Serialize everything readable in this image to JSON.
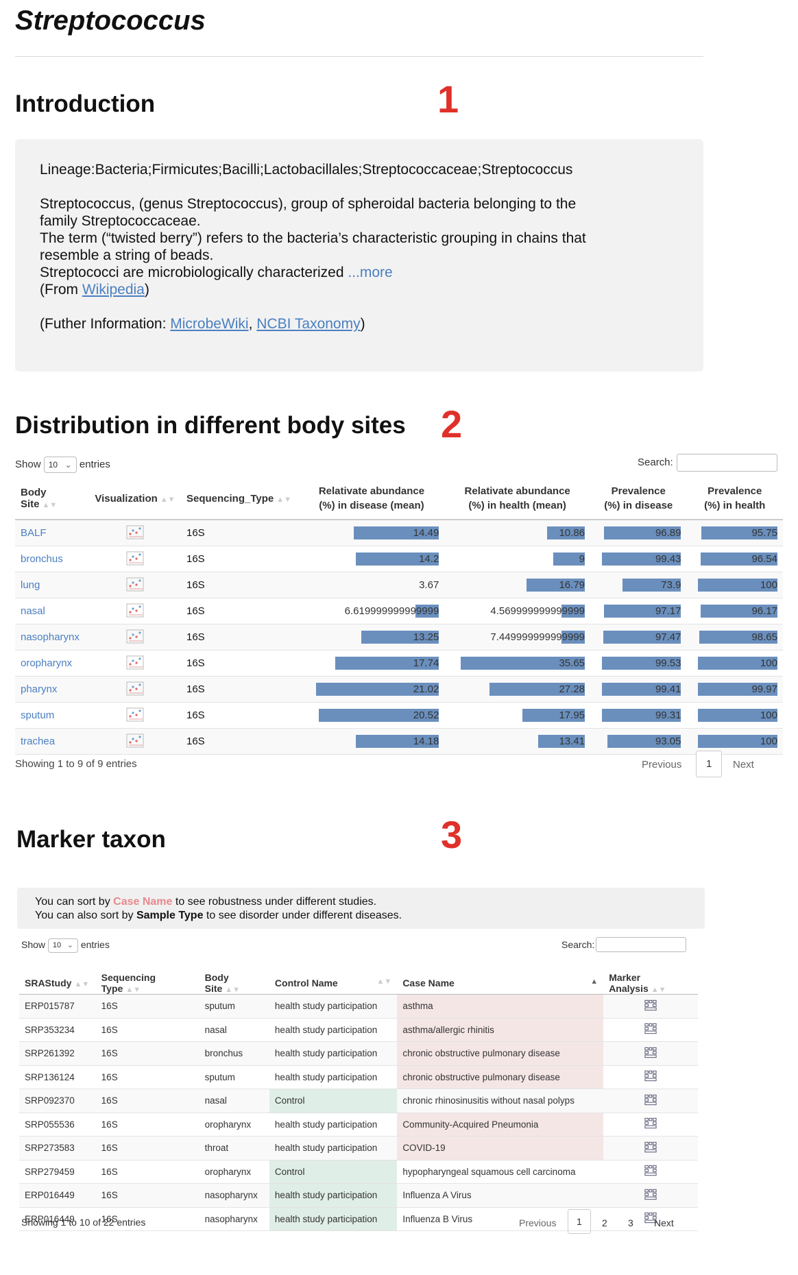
{
  "page": {
    "title": "Streptococcus"
  },
  "markers": [
    "1",
    "2",
    "3"
  ],
  "introduction": {
    "heading": "Introduction",
    "lineage": "Lineage:Bacteria;Firmicutes;Bacilli;Lactobacillales;Streptococcaceae;Streptococcus",
    "desc_line1": "Streptococcus, (genus Streptococcus), group of spheroidal bacteria belonging to the",
    "desc_line2": "family Streptococcaceae.",
    "desc_line3": "The term (“twisted berry”) refers to the bacteria’s characteristic grouping in chains that",
    "desc_line4": "resemble a string of beads.",
    "desc_line5": "Streptococci are microbiologically characterized ",
    "more_link": "...more",
    "from_prefix": "(From ",
    "wikipedia_link": "Wikipedia",
    "from_suffix": ")",
    "further_prefix": "(Futher Information: ",
    "microbewiki_link": "MicrobeWiki",
    "separator": ", ",
    "ncbi_link": "NCBI Taxonomy",
    "further_suffix": ")"
  },
  "distribution": {
    "heading": "Distribution in different body sites",
    "show_label": "Show",
    "entries_value": "10",
    "entries_label": "entries",
    "search_label": "Search:",
    "columns": {
      "body_site": "Body Site",
      "visualization": "Visualization",
      "sequencing_type": "Sequencing_Type",
      "abund_disease_1": "Relativate abundance",
      "abund_disease_2": "(%) in disease (mean)",
      "abund_health_1": "Relativate abundance",
      "abund_health_2": "(%) in health (mean)",
      "prev_disease_1": "Prevalence",
      "prev_disease_2": "(%) in disease",
      "prev_health_1": "Prevalence",
      "prev_health_2": "(%) in health"
    },
    "rows": [
      {
        "site": "BALF",
        "seq": "16S",
        "ad": "14.49",
        "ah": "10.86",
        "pd": "96.89",
        "ph": "95.75",
        "adv": 14.49,
        "ahv": 10.86,
        "pdv": 96.89,
        "phv": 95.75
      },
      {
        "site": "bronchus",
        "seq": "16S",
        "ad": "14.2",
        "ah": "9",
        "pd": "99.43",
        "ph": "96.54",
        "adv": 14.2,
        "ahv": 9,
        "pdv": 99.43,
        "phv": 96.54
      },
      {
        "site": "lung",
        "seq": "16S",
        "ad": "3.67",
        "ah": "16.79",
        "pd": "73.9",
        "ph": "100",
        "adv": 3.67,
        "ahv": 16.79,
        "pdv": 73.9,
        "phv": 100
      },
      {
        "site": "nasal",
        "seq": "16S",
        "ad": "6.619999999999999",
        "ah": "4.569999999999999",
        "pd": "97.17",
        "ph": "96.17",
        "adv": 6.62,
        "ahv": 4.57,
        "pdv": 97.17,
        "phv": 96.17
      },
      {
        "site": "nasopharynx",
        "seq": "16S",
        "ad": "13.25",
        "ah": "7.449999999999999",
        "pd": "97.47",
        "ph": "98.65",
        "adv": 13.25,
        "ahv": 7.45,
        "pdv": 97.47,
        "phv": 98.65
      },
      {
        "site": "oropharynx",
        "seq": "16S",
        "ad": "17.74",
        "ah": "35.65",
        "pd": "99.53",
        "ph": "100",
        "adv": 17.74,
        "ahv": 35.65,
        "pdv": 99.53,
        "phv": 100
      },
      {
        "site": "pharynx",
        "seq": "16S",
        "ad": "21.02",
        "ah": "27.28",
        "pd": "99.41",
        "ph": "99.97",
        "adv": 21.02,
        "ahv": 27.28,
        "pdv": 99.41,
        "phv": 99.97
      },
      {
        "site": "sputum",
        "seq": "16S",
        "ad": "20.52",
        "ah": "17.95",
        "pd": "99.31",
        "ph": "100",
        "adv": 20.52,
        "ahv": 17.95,
        "pdv": 99.31,
        "phv": 100
      },
      {
        "site": "trachea",
        "seq": "16S",
        "ad": "14.18",
        "ah": "13.41",
        "pd": "93.05",
        "ph": "100",
        "adv": 14.18,
        "ahv": 13.41,
        "pdv": 93.05,
        "phv": 100
      }
    ],
    "showing": "Showing 1 to 9 of 9 entries",
    "previous": "Previous",
    "page": "1",
    "next": "Next"
  },
  "marker_taxon": {
    "heading": "Marker taxon",
    "info1_a": "You can sort by ",
    "info1_b": "Case Name",
    "info1_c": " to see robustness under different studies.",
    "info2_a": "You can also sort by ",
    "info2_b": "Sample Type",
    "info2_c": " to see disorder under different diseases.",
    "show_label": "Show",
    "entries_value": "10",
    "entries_label": "entries",
    "search_label": "Search:",
    "columns": {
      "study": "SRAStudy",
      "seq": "Sequencing Type",
      "site": "Body Site",
      "control": "Control Name",
      "case": "Case Name",
      "marker": "Marker Analysis"
    },
    "rows": [
      {
        "study": "ERP015787",
        "seq": "16S",
        "site": "sputum",
        "control": "health study participation",
        "case": "asthma",
        "ctrl_hl": false,
        "case_hl": true
      },
      {
        "study": "SRP353234",
        "seq": "16S",
        "site": "nasal",
        "control": "health study participation",
        "case": "asthma/allergic rhinitis",
        "ctrl_hl": false,
        "case_hl": true
      },
      {
        "study": "SRP261392",
        "seq": "16S",
        "site": "bronchus",
        "control": "health study participation",
        "case": "chronic obstructive pulmonary disease",
        "ctrl_hl": false,
        "case_hl": true
      },
      {
        "study": "SRP136124",
        "seq": "16S",
        "site": "sputum",
        "control": "health study participation",
        "case": "chronic obstructive pulmonary disease",
        "ctrl_hl": false,
        "case_hl": true
      },
      {
        "study": "SRP092370",
        "seq": "16S",
        "site": "nasal",
        "control": "Control",
        "case": "chronic rhinosinusitis without nasal polyps",
        "ctrl_hl": true,
        "case_hl": false
      },
      {
        "study": "SRP055536",
        "seq": "16S",
        "site": "oropharynx",
        "control": "health study participation",
        "case": "Community-Acquired Pneumonia",
        "ctrl_hl": false,
        "case_hl": true
      },
      {
        "study": "SRP273583",
        "seq": "16S",
        "site": "throat",
        "control": "health study participation",
        "case": "COVID-19",
        "ctrl_hl": false,
        "case_hl": true
      },
      {
        "study": "SRP279459",
        "seq": "16S",
        "site": "oropharynx",
        "control": "Control",
        "case": "hypopharyngeal squamous cell carcinoma",
        "ctrl_hl": true,
        "case_hl": false
      },
      {
        "study": "ERP016449",
        "seq": "16S",
        "site": "nasopharynx",
        "control": "health study participation",
        "case": "Influenza A Virus",
        "ctrl_hl": true,
        "case_hl": false
      },
      {
        "study": "ERP016449",
        "seq": "16S",
        "site": "nasopharynx",
        "control": "health study participation",
        "case": "Influenza B Virus",
        "ctrl_hl": true,
        "case_hl": false
      }
    ],
    "showing": "Showing 1 to 10 of 22 entries",
    "previous": "Previous",
    "pages": [
      "1",
      "2",
      "3"
    ],
    "next": "Next"
  },
  "icons": {
    "visualization": "scatter-chart-icon",
    "marker_analysis": "grid-network-icon",
    "sort": "sort-arrows-icon",
    "dropdown": "chevron-down-icon"
  },
  "colors": {
    "link": "#4a7fc1",
    "bar": "#6a8fbd",
    "marker": "#e0302a",
    "case_highlight": "#f5e6e6",
    "control_highlight": "#dfeee6",
    "pink_text": "#e8898e"
  }
}
